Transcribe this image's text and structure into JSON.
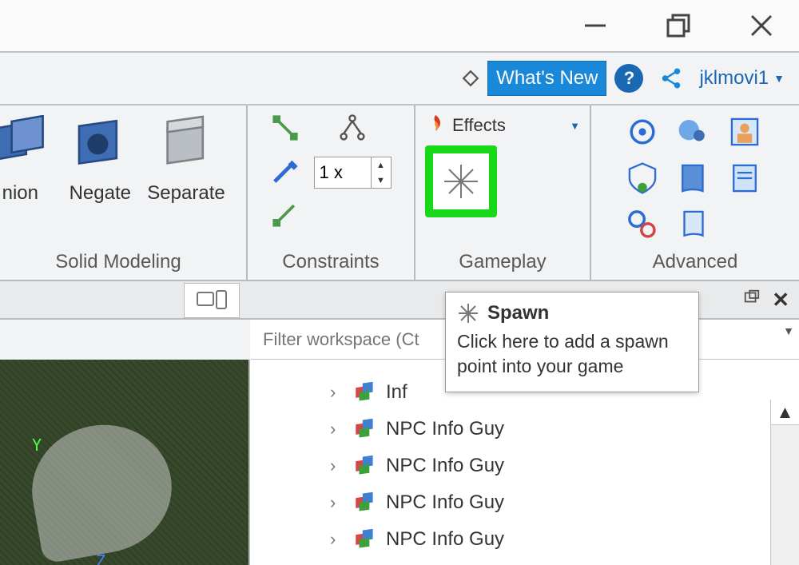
{
  "window": {
    "minimize": "–",
    "maximize": "❐",
    "close": "✕"
  },
  "topbar": {
    "whats_new": "What's New",
    "username": "jklmovi1"
  },
  "ribbon": {
    "solid_modeling": {
      "label": "Solid Modeling",
      "union": "nion",
      "negate": "Negate",
      "separate": "Separate"
    },
    "constraints": {
      "label": "Constraints",
      "scale_value": "1 x"
    },
    "gameplay": {
      "label": "Gameplay",
      "effects_label": "Effects"
    },
    "advanced": {
      "label": "Advanced"
    }
  },
  "filter": {
    "placeholder": "Filter workspace (Ct"
  },
  "tree": {
    "items": [
      {
        "label": "Inf"
      },
      {
        "label": "NPC Info Guy"
      },
      {
        "label": "NPC Info Guy"
      },
      {
        "label": "NPC Info Guy"
      },
      {
        "label": "NPC Info Guy"
      }
    ]
  },
  "tooltip": {
    "title": "Spawn",
    "body": "Click here to add a spawn point into your game"
  }
}
